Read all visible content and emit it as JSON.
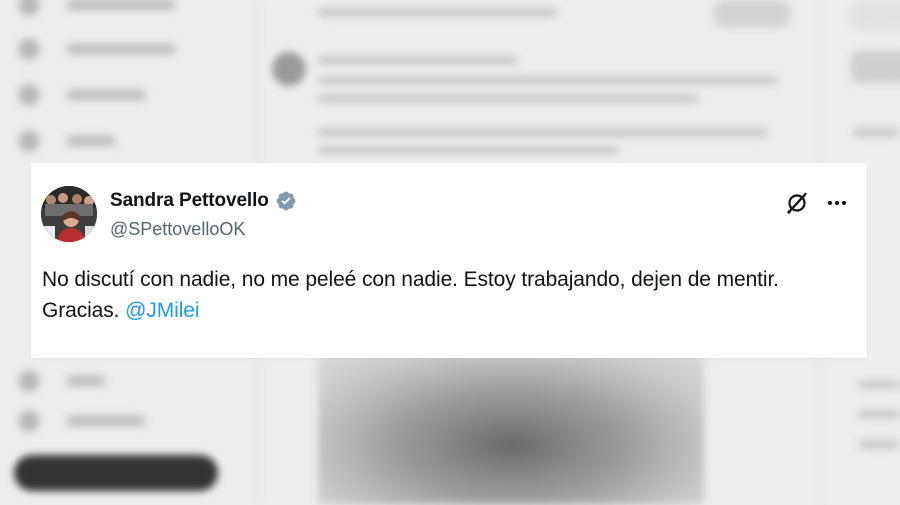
{
  "tweet": {
    "display_name": "Sandra Pettovello",
    "handle": "@SPettovelloOK",
    "verified": true,
    "text_before_mention": "No discutí con nadie, no me peleé con nadie. Estoy trabajando, dejen de mentir. Gracias. ",
    "mention": "@JMilei",
    "avatar_icon": "profile-photo",
    "action_icons": [
      "grok-icon",
      "more-options-icon"
    ]
  },
  "colors": {
    "background": "#eeeeee",
    "card": "#ffffff",
    "text_primary": "#0f1419",
    "text_secondary": "#536471",
    "link": "#1d9bf0",
    "verified_badge": "#829aab"
  }
}
